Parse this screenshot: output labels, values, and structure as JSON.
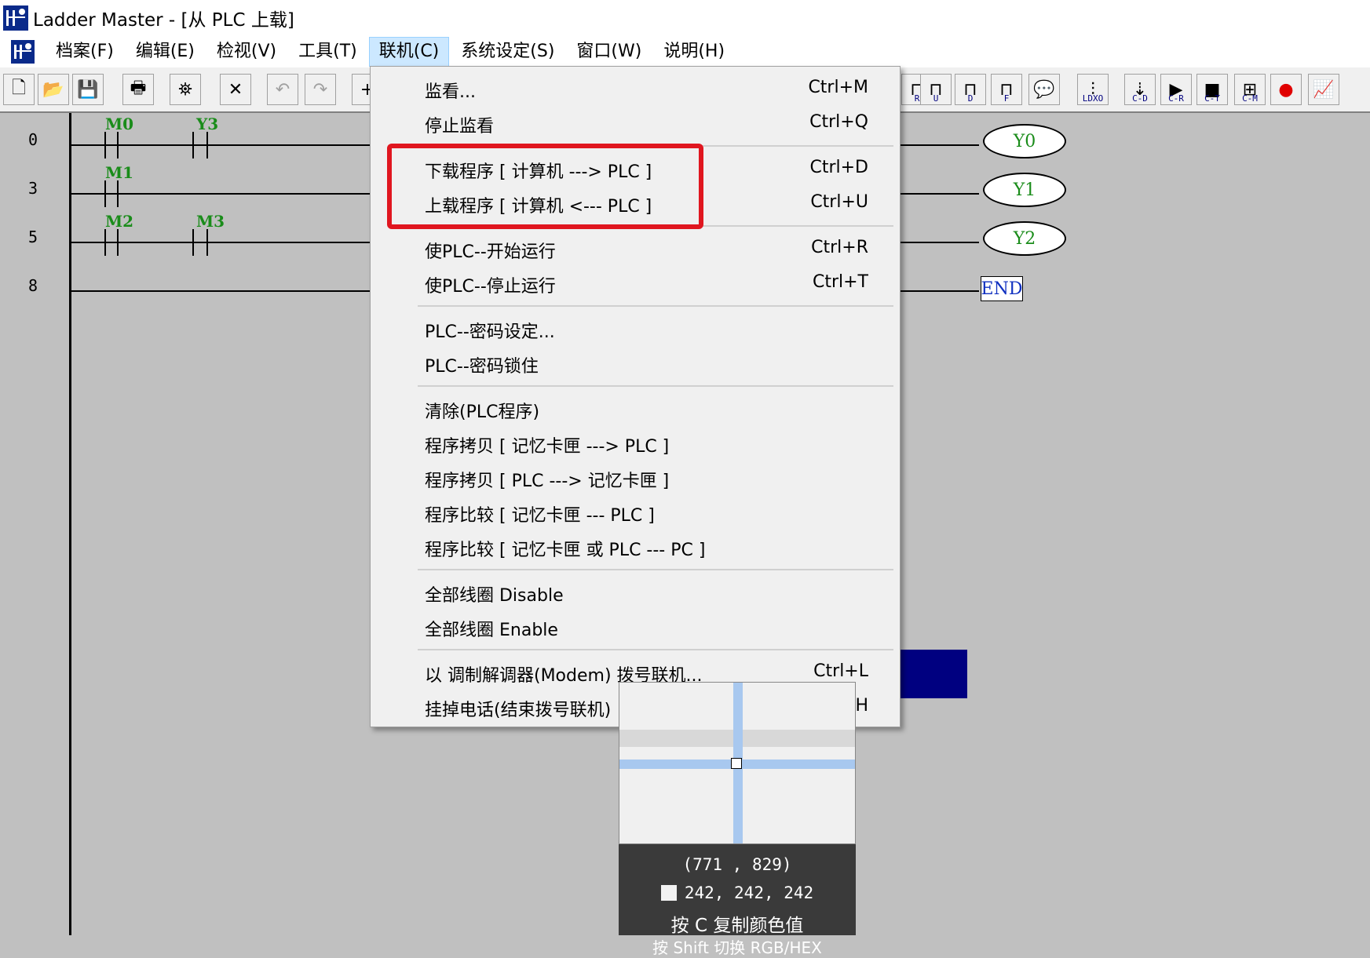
{
  "window": {
    "title": "Ladder Master - [从 PLC 上载]"
  },
  "menubar": {
    "items": [
      "档案(F)",
      "编辑(E)",
      "检视(V)",
      "工具(T)",
      "联机(C)",
      "系统设定(S)",
      "窗口(W)",
      "说明(H)"
    ],
    "active_index": 4
  },
  "toolbar": {
    "icons": [
      "new-file-icon",
      "open-folder-icon",
      "save-disk-icon",
      "print-icon",
      "find-binoculars-icon",
      "delete-x-icon",
      "undo-icon",
      "redo-icon"
    ],
    "right_labels": [
      "R",
      "U",
      "D",
      "F",
      "",
      "LDXO",
      "C-D",
      "C-R",
      "C-T",
      "C-M",
      "",
      ""
    ]
  },
  "ladder": {
    "rungs": [
      {
        "step": "0",
        "contacts": [
          "M0",
          "Y3"
        ],
        "coil": "Y0"
      },
      {
        "step": "3",
        "contacts": [
          "M1"
        ],
        "coil": "Y1"
      },
      {
        "step": "5",
        "contacts": [
          "M2",
          "M3"
        ],
        "coil": "Y2"
      },
      {
        "step": "8",
        "contacts": [],
        "coil": "END"
      }
    ]
  },
  "dropdown": {
    "items": [
      {
        "label": "监看...",
        "shortcut": "Ctrl+M"
      },
      {
        "label": "停止监看",
        "shortcut": "Ctrl+Q"
      },
      {
        "label": "下载程序 [ 计算机 ---> PLC ]",
        "shortcut": "Ctrl+D"
      },
      {
        "label": "上载程序 [ 计算机 <--- PLC ]",
        "shortcut": "Ctrl+U"
      },
      {
        "label": "使PLC--开始运行",
        "shortcut": "Ctrl+R"
      },
      {
        "label": "使PLC--停止运行",
        "shortcut": "Ctrl+T"
      },
      {
        "label": "PLC--密码设定...",
        "shortcut": ""
      },
      {
        "label": "PLC--密码锁住",
        "shortcut": ""
      },
      {
        "label": "清除(PLC程序)",
        "shortcut": ""
      },
      {
        "label": "程序拷贝  [ 记忆卡匣 ---> PLC ]",
        "shortcut": ""
      },
      {
        "label": "程序拷贝  [ PLC ---> 记忆卡匣 ]",
        "shortcut": ""
      },
      {
        "label": "程序比较  [ 记忆卡匣  ---   PLC ]",
        "shortcut": ""
      },
      {
        "label": "程序比较  [ 记忆卡匣 或 PLC  ---   PC ]",
        "shortcut": ""
      },
      {
        "label": "全部线圈 Disable",
        "shortcut": ""
      },
      {
        "label": "全部线圈 Enable",
        "shortcut": ""
      },
      {
        "label": "以 调制解调器(Modem) 拨号联机...",
        "shortcut": "Ctrl+L"
      },
      {
        "label": "挂掉电话(结束拨号联机)",
        "shortcut": "Ctrl+H"
      }
    ]
  },
  "picker": {
    "coords": "(771 , 829)",
    "rgb": "242, 242, 242",
    "hint": "按 C 复制颜色值",
    "hint2": "按 Shift 切换 RGB/HEX"
  },
  "colors": {
    "highlight": "#e0161f",
    "menu_active": "#cce8ff",
    "contact_label": "#1a8c1a"
  }
}
